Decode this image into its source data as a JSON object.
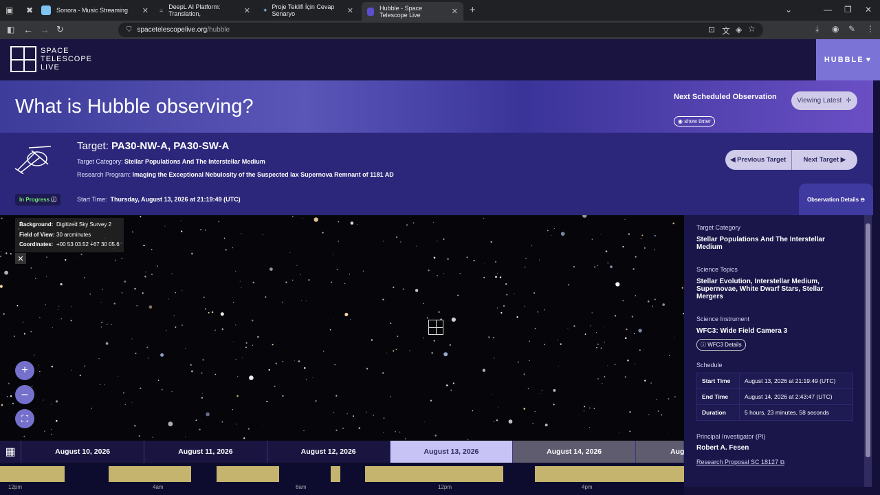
{
  "browser": {
    "tabs": [
      {
        "title": "Sonora - Music Streaming"
      },
      {
        "title": "DeepL AI Platform: Translation,"
      },
      {
        "title": "Proje Teklifi İçin Cevap Senaryo"
      },
      {
        "title": "Hubble - Space Telescope Live"
      }
    ],
    "url_domain": "spacetelescopelive.org",
    "url_path": "/hubble"
  },
  "site": {
    "logo_line1": "SPACE",
    "logo_line2": "TELESCOPE",
    "logo_line3": "LIVE",
    "menu_label": "HUBBLE"
  },
  "banner": {
    "headline": "What is Hubble observing?",
    "next_scheduled": "Next Scheduled Observation",
    "show_timer": "show timer",
    "viewing_latest": "Viewing Latest"
  },
  "target": {
    "prefix": "Target: ",
    "name": "PA30-NW-A, PA30-SW-A",
    "category_label": "Target Category: ",
    "category": "Stellar Populations And The Interstellar Medium",
    "program_label": "Research Program: ",
    "program": "Imaging the Exceptional Nebulosity of the Suspected Iax Supernova Remnant of 1181 AD",
    "status": "In Progress",
    "start_label": "Start Time:",
    "start_value": "Thursday, August 13, 2026 at 21:19:49 (UTC)",
    "prev": "Previous Target",
    "next": "Next Target",
    "obs_details": "Observation Details"
  },
  "sky": {
    "bg_label": "Background:",
    "bg_value": "Digitized Sky Survey 2",
    "fov_label": "Field of View:",
    "fov_value": "30 arcminutes",
    "coord_label": "Coordinates:",
    "coord_value": "+00 53 03.52 +67 30 05.6"
  },
  "details": {
    "cat_label": "Target Category",
    "cat_value": "Stellar Populations And The Interstellar Medium",
    "topics_label": "Science Topics",
    "topics_value": "Stellar Evolution, Interstellar Medium, Supernovae, White Dwarf Stars, Stellar Mergers",
    "instr_label": "Science Instrument",
    "instr_value": "WFC3: Wide Field Camera 3",
    "instr_btn": "WFC3 Details",
    "sched_label": "Schedule",
    "schedule": [
      {
        "k": "Start Time",
        "v": "August 13, 2026 at 21:19:49 (UTC)"
      },
      {
        "k": "End Time",
        "v": "August 14, 2026 at 2:43:47 (UTC)"
      },
      {
        "k": "Duration",
        "v": "5 hours, 23 minutes, 58 seconds"
      }
    ],
    "pi_label": "Principal Investigator (PI)",
    "pi_value": "Robert A. Fesen",
    "proposal": "Research Proposal SC 18127"
  },
  "timeline": {
    "days": [
      "August 10, 2026",
      "August 11, 2026",
      "August 12, 2026",
      "August 13, 2026",
      "August 14, 2026",
      "Aug"
    ],
    "ticks": [
      "12pm",
      "4am",
      "8am",
      "12pm",
      "4pm"
    ]
  },
  "colors": {
    "accent": "#7b74d6",
    "status": "#6ee06e",
    "block": "#c4b46e"
  }
}
